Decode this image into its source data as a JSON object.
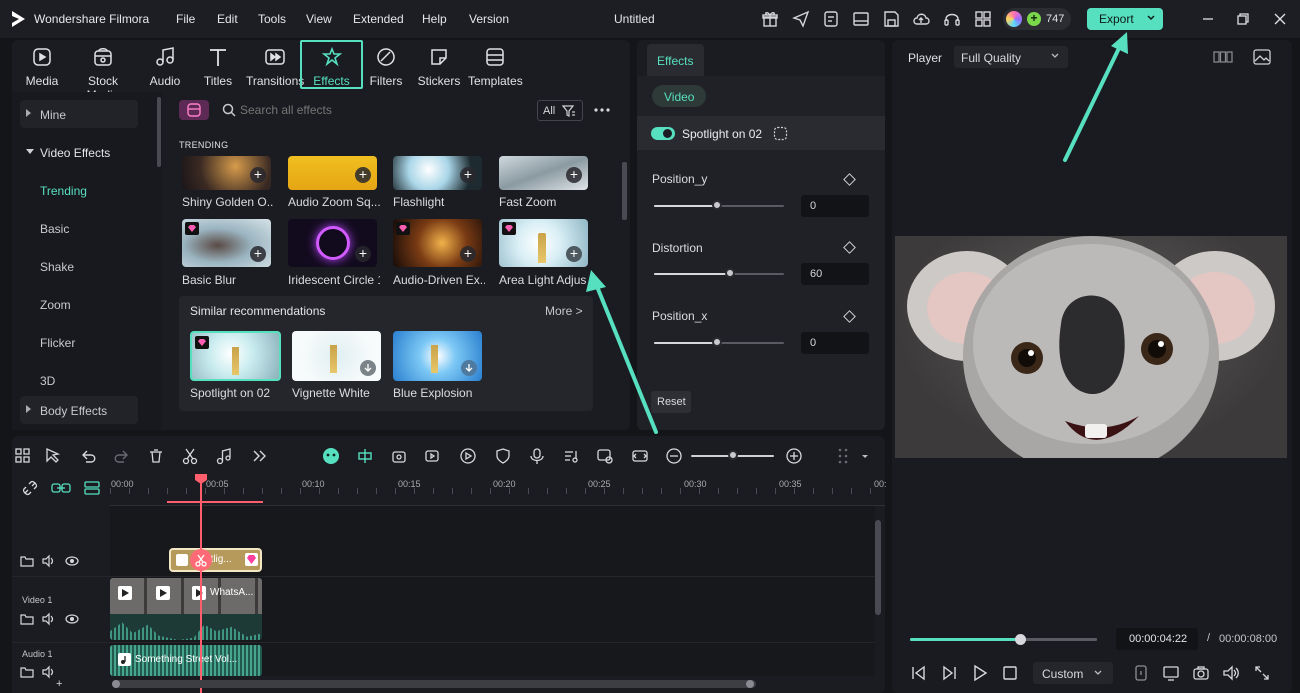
{
  "app": {
    "name": "Wondershare Filmora",
    "project_title": "Untitled",
    "menu": [
      "File",
      "Edit",
      "Tools",
      "View",
      "Extended",
      "Help",
      "Version"
    ],
    "credits": "747",
    "export_label": "Export"
  },
  "toolbar_tabs": [
    {
      "label": "Media",
      "icon": "media-icon"
    },
    {
      "label": "Stock Media",
      "icon": "stock-media-icon"
    },
    {
      "label": "Audio",
      "icon": "audio-icon"
    },
    {
      "label": "Titles",
      "icon": "titles-icon"
    },
    {
      "label": "Transitions",
      "icon": "transitions-icon"
    },
    {
      "label": "Effects",
      "icon": "effects-icon",
      "active": true
    },
    {
      "label": "Filters",
      "icon": "filters-icon"
    },
    {
      "label": "Stickers",
      "icon": "stickers-icon"
    },
    {
      "label": "Templates",
      "icon": "templates-icon"
    }
  ],
  "sidebar": {
    "items": [
      {
        "label": "Mine"
      },
      {
        "label": "Video Effects"
      },
      {
        "label": "Trending",
        "active": true
      },
      {
        "label": "Basic"
      },
      {
        "label": "Shake"
      },
      {
        "label": "Zoom"
      },
      {
        "label": "Flicker"
      },
      {
        "label": "3D"
      },
      {
        "label": "Body Effects"
      }
    ]
  },
  "effects_browser": {
    "search_placeholder": "Search all effects",
    "filter_label": "All",
    "section_title": "TRENDING",
    "row1": [
      "Shiny Golden O...",
      "Audio Zoom Sq...",
      "Flashlight",
      "Fast Zoom"
    ],
    "row2": [
      "Basic Blur",
      "Iridescent Circle 1",
      "Audio-Driven Ex...",
      "Area Light Adjus"
    ],
    "similar": {
      "title": "Similar recommendations",
      "more": "More >",
      "items": [
        "Spotlight on 02",
        "Vignette White",
        "Blue Explosion"
      ]
    }
  },
  "properties": {
    "tab": "Effects",
    "subtab": "Video",
    "effect_name": "Spotlight on 02",
    "params": [
      {
        "label": "Position_y",
        "value": "0",
        "level": 0.5
      },
      {
        "label": "Distortion",
        "value": "60",
        "level": 0.6
      },
      {
        "label": "Position_x",
        "value": "0",
        "level": 0.5
      }
    ],
    "reset_label": "Reset"
  },
  "player": {
    "label": "Player",
    "quality": "Full Quality",
    "current_time": "00:00:04:22",
    "separator": "/",
    "total_time": "00:00:08:00",
    "progress": 0.58,
    "zoom_option": "Custom"
  },
  "timeline": {
    "ruler": [
      "00:00",
      "00:05",
      "00:10",
      "00:15",
      "00:20",
      "00:25",
      "00:30",
      "00:35",
      "00:"
    ],
    "tracks": {
      "video1": "Video 1",
      "audio1": "Audio 1"
    },
    "effect_clip": "otlig...",
    "video_clip": "WhatsA...",
    "audio_clip": "Something Street Vol..."
  },
  "colors": {
    "accent": "#57e0c0",
    "background": "#141519",
    "panel": "#1b1c21",
    "playhead": "#ff5f6d"
  }
}
